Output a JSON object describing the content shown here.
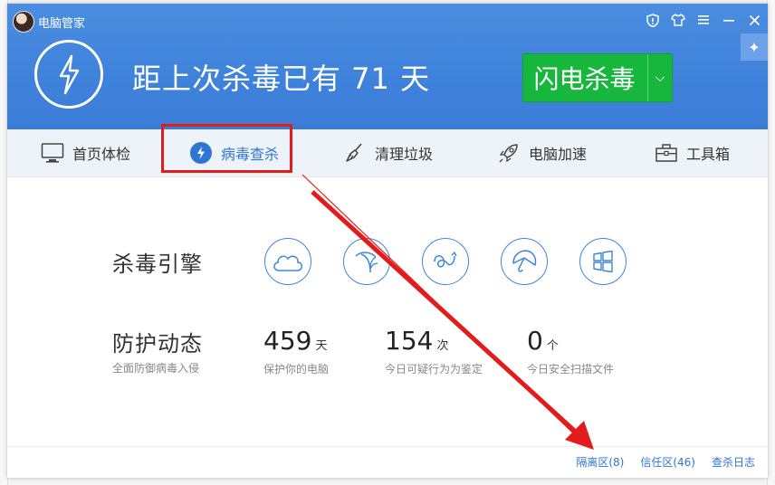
{
  "window": {
    "title": "电脑管家",
    "controls": [
      "shield-icon",
      "shirt-icon",
      "menu-icon",
      "minimize-icon",
      "close-icon"
    ]
  },
  "hero": {
    "text": "距上次杀毒已有 71 天",
    "scan_button_label": "闪电杀毒",
    "scan_button_arrow": "⌵"
  },
  "nav": {
    "items": [
      {
        "label": "首页体检",
        "icon": "monitor-icon"
      },
      {
        "label": "病毒查杀",
        "icon": "bolt-icon",
        "active": true
      },
      {
        "label": "清理垃圾",
        "icon": "broom-icon"
      },
      {
        "label": "电脑加速",
        "icon": "rocket-icon"
      },
      {
        "label": "工具箱",
        "icon": "toolbox-icon"
      }
    ]
  },
  "engine": {
    "label": "杀毒引擎",
    "icons": [
      "cloud-engine-icon",
      "palm-engine-icon",
      "swirl-engine-icon",
      "umbrella-engine-icon",
      "windows-engine-icon"
    ]
  },
  "protection": {
    "title": "防护动态",
    "subtitle": "全面防御病毒入侵",
    "stats": [
      {
        "value": "459",
        "unit": "天",
        "desc": "保护你的电脑"
      },
      {
        "value": "154",
        "unit": "次",
        "desc": "今日可疑行为为鉴定"
      },
      {
        "value": "0",
        "unit": "个",
        "desc": "今日安全扫描文件"
      }
    ]
  },
  "footer": {
    "links": [
      "隔离区(8)",
      "信任区(46)",
      "查杀日志"
    ]
  },
  "colors": {
    "header_blue": "#4289dd",
    "accent_blue": "#2f75d4",
    "scan_green": "#17b63c",
    "annotation_red": "#e21b1b"
  }
}
